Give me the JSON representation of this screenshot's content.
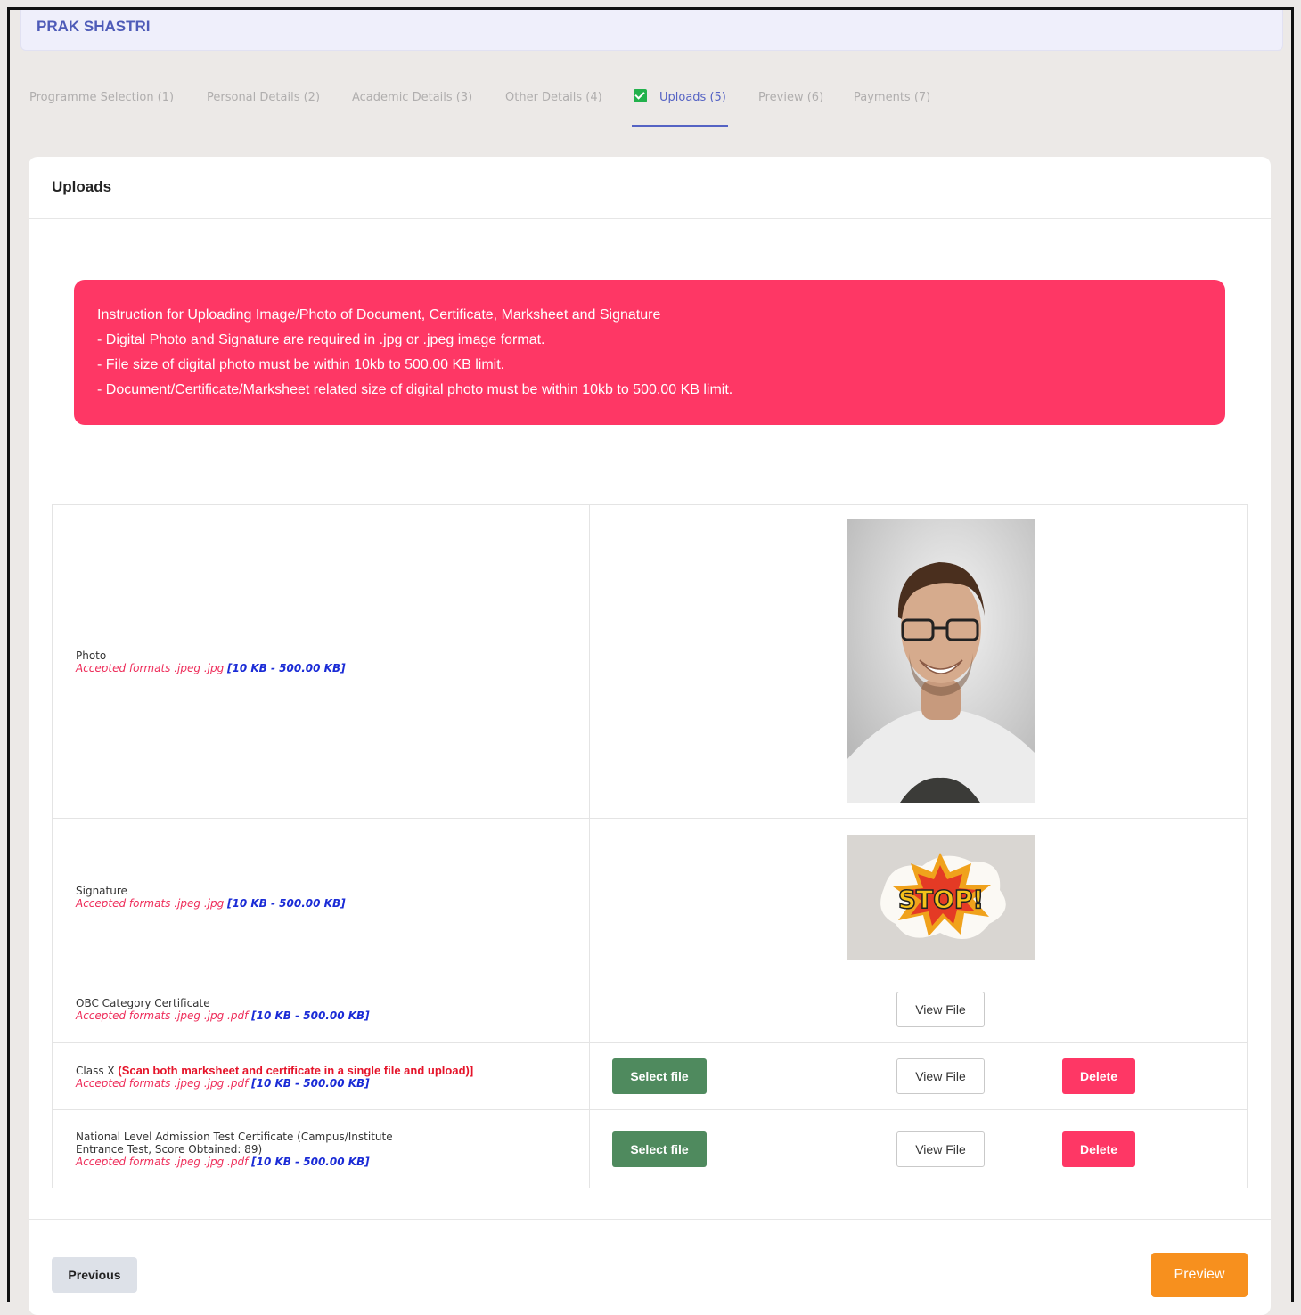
{
  "applicant": {
    "name": "PRAK SHASTRI"
  },
  "tabs": [
    {
      "label": "Programme Selection (1)"
    },
    {
      "label": "Personal Details (2)"
    },
    {
      "label": "Academic Details (3)"
    },
    {
      "label": "Other Details (4)"
    },
    {
      "label": "Uploads (5)",
      "active": true
    },
    {
      "label": "Preview (6)"
    },
    {
      "label": "Payments (7)"
    }
  ],
  "card": {
    "title": "Uploads"
  },
  "instructions": {
    "lines": [
      "Instruction for Uploading Image/Photo of Document, Certificate, Marksheet and Signature",
      "- Digital Photo and Signature are required in .jpg or .jpeg image format.",
      "- File size of digital photo must be within 10kb to 500.00 KB limit.",
      "- Document/Certificate/Marksheet related size of digital photo must be within 10kb to 500.00 KB limit."
    ]
  },
  "uploads": [
    {
      "label": "Photo",
      "formats": "Accepted formats .jpeg .jpg ",
      "size": "[10 KB - 500.00 KB]"
    },
    {
      "label": "Signature",
      "formats": "Accepted formats .jpeg .jpg ",
      "size": "[10 KB - 500.00 KB]",
      "image_text": "STOP!"
    },
    {
      "label": "OBC Category Certificate",
      "formats": "Accepted formats .jpeg .jpg .pdf ",
      "size": "[10 KB - 500.00 KB]"
    },
    {
      "label": "Class X ",
      "note": "(Scan both marksheet and certificate in a single file and upload)]",
      "formats": "Accepted formats .jpeg .jpg .pdf ",
      "size": "[10 KB - 500.00 KB]"
    },
    {
      "label_line1": "National Level Admission Test Certificate (Campus/Institute",
      "label_line2": "Entrance Test, Score Obtained: 89)",
      "formats": "Accepted formats .jpeg .jpg .pdf ",
      "size": "[10 KB - 500.00 KB]"
    }
  ],
  "buttons": {
    "select_file": "Select file",
    "view_file": "View File",
    "delete": "Delete",
    "previous": "Previous",
    "preview": "Preview"
  },
  "colors": {
    "accent": "#5563c4",
    "alert": "#fe3765",
    "select": "#4f8a5e",
    "preview": "#f7901e"
  }
}
